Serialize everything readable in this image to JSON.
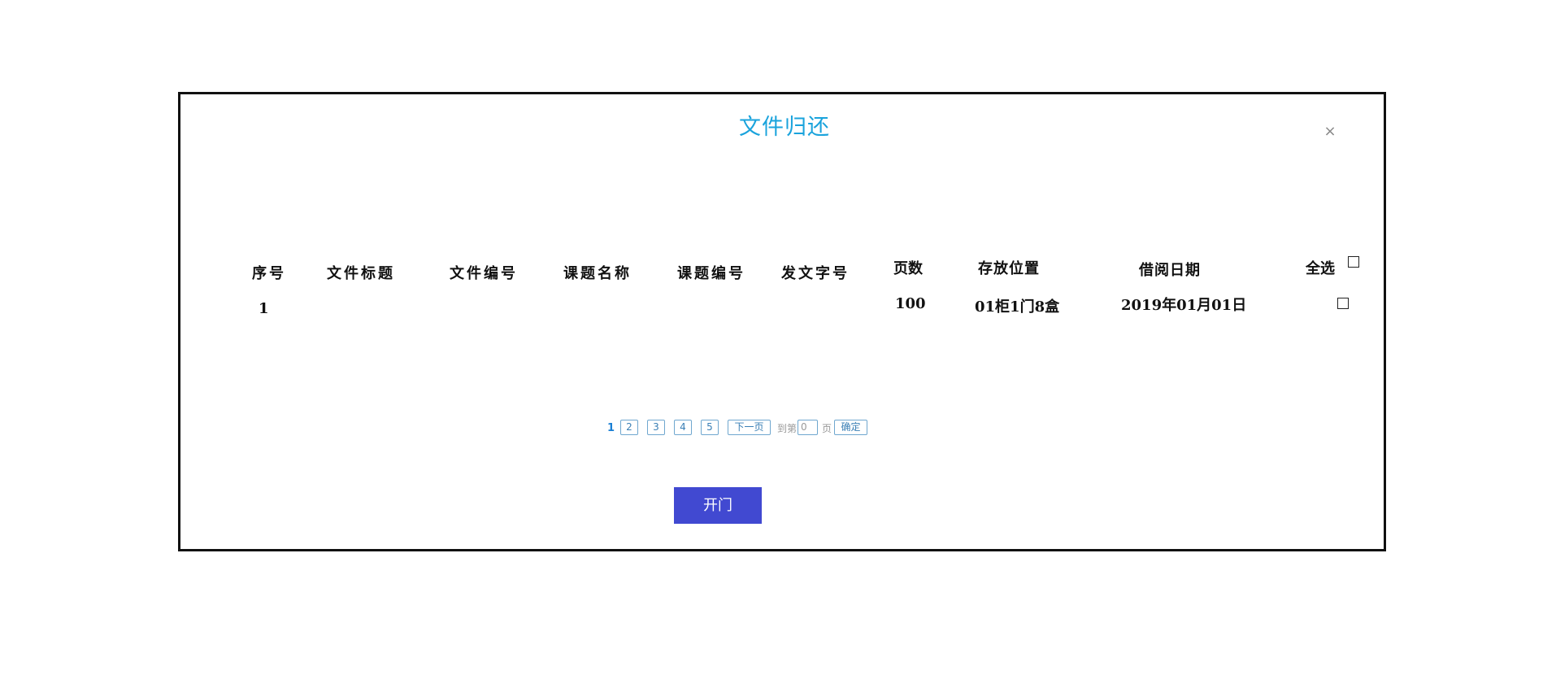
{
  "dialog": {
    "title": "文件归还",
    "close_label": "×"
  },
  "table": {
    "headers": {
      "index": "序号",
      "file_title": "文件标题",
      "file_number": "文件编号",
      "topic_name": "课题名称",
      "topic_number": "课题编号",
      "issue_number": "发文字号",
      "pages": "页数",
      "location": "存放位置",
      "borrow_date": "借阅日期",
      "select_all": "全选"
    },
    "rows": [
      {
        "index": "1",
        "file_title": "",
        "file_number": "",
        "topic_name": "",
        "topic_number": "",
        "issue_number": "",
        "pages": "100",
        "location": "01柜1门8盒",
        "borrow_date": "2019年01月01日",
        "selected": false
      }
    ],
    "select_all_checked": false
  },
  "pagination": {
    "current": "1",
    "pages": [
      "2",
      "3",
      "4",
      "5"
    ],
    "next_label": "下一页",
    "goto_prefix": "到第",
    "goto_value": "0",
    "goto_suffix": "页",
    "confirm_label": "确定"
  },
  "actions": {
    "open_door_label": "开门",
    "open_door_color": "#4149d1"
  },
  "colors": {
    "title": "#1aa3dc",
    "pager_active": "#1a7fd4",
    "pager_border": "#6fa7cf"
  }
}
